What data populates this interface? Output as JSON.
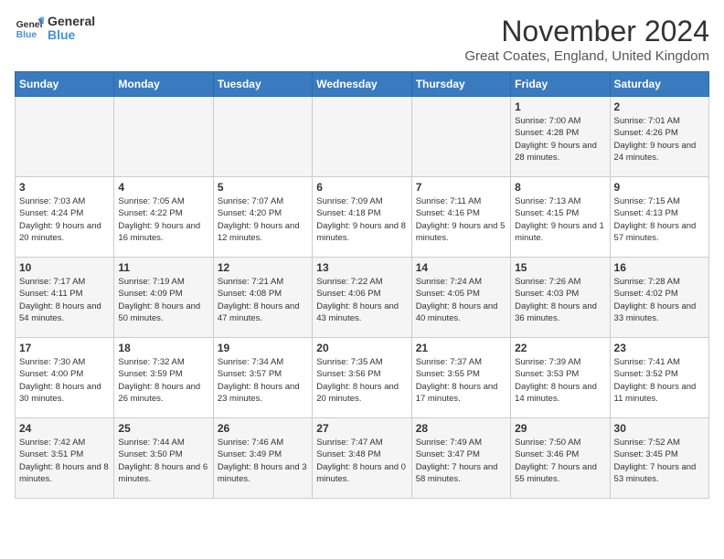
{
  "logo": {
    "general": "General",
    "blue": "Blue"
  },
  "title": "November 2024",
  "subtitle": "Great Coates, England, United Kingdom",
  "days_of_week": [
    "Sunday",
    "Monday",
    "Tuesday",
    "Wednesday",
    "Thursday",
    "Friday",
    "Saturday"
  ],
  "weeks": [
    [
      {
        "day": "",
        "info": ""
      },
      {
        "day": "",
        "info": ""
      },
      {
        "day": "",
        "info": ""
      },
      {
        "day": "",
        "info": ""
      },
      {
        "day": "",
        "info": ""
      },
      {
        "day": "1",
        "info": "Sunrise: 7:00 AM\nSunset: 4:28 PM\nDaylight: 9 hours and 28 minutes."
      },
      {
        "day": "2",
        "info": "Sunrise: 7:01 AM\nSunset: 4:26 PM\nDaylight: 9 hours and 24 minutes."
      }
    ],
    [
      {
        "day": "3",
        "info": "Sunrise: 7:03 AM\nSunset: 4:24 PM\nDaylight: 9 hours and 20 minutes."
      },
      {
        "day": "4",
        "info": "Sunrise: 7:05 AM\nSunset: 4:22 PM\nDaylight: 9 hours and 16 minutes."
      },
      {
        "day": "5",
        "info": "Sunrise: 7:07 AM\nSunset: 4:20 PM\nDaylight: 9 hours and 12 minutes."
      },
      {
        "day": "6",
        "info": "Sunrise: 7:09 AM\nSunset: 4:18 PM\nDaylight: 9 hours and 8 minutes."
      },
      {
        "day": "7",
        "info": "Sunrise: 7:11 AM\nSunset: 4:16 PM\nDaylight: 9 hours and 5 minutes."
      },
      {
        "day": "8",
        "info": "Sunrise: 7:13 AM\nSunset: 4:15 PM\nDaylight: 9 hours and 1 minute."
      },
      {
        "day": "9",
        "info": "Sunrise: 7:15 AM\nSunset: 4:13 PM\nDaylight: 8 hours and 57 minutes."
      }
    ],
    [
      {
        "day": "10",
        "info": "Sunrise: 7:17 AM\nSunset: 4:11 PM\nDaylight: 8 hours and 54 minutes."
      },
      {
        "day": "11",
        "info": "Sunrise: 7:19 AM\nSunset: 4:09 PM\nDaylight: 8 hours and 50 minutes."
      },
      {
        "day": "12",
        "info": "Sunrise: 7:21 AM\nSunset: 4:08 PM\nDaylight: 8 hours and 47 minutes."
      },
      {
        "day": "13",
        "info": "Sunrise: 7:22 AM\nSunset: 4:06 PM\nDaylight: 8 hours and 43 minutes."
      },
      {
        "day": "14",
        "info": "Sunrise: 7:24 AM\nSunset: 4:05 PM\nDaylight: 8 hours and 40 minutes."
      },
      {
        "day": "15",
        "info": "Sunrise: 7:26 AM\nSunset: 4:03 PM\nDaylight: 8 hours and 36 minutes."
      },
      {
        "day": "16",
        "info": "Sunrise: 7:28 AM\nSunset: 4:02 PM\nDaylight: 8 hours and 33 minutes."
      }
    ],
    [
      {
        "day": "17",
        "info": "Sunrise: 7:30 AM\nSunset: 4:00 PM\nDaylight: 8 hours and 30 minutes."
      },
      {
        "day": "18",
        "info": "Sunrise: 7:32 AM\nSunset: 3:59 PM\nDaylight: 8 hours and 26 minutes."
      },
      {
        "day": "19",
        "info": "Sunrise: 7:34 AM\nSunset: 3:57 PM\nDaylight: 8 hours and 23 minutes."
      },
      {
        "day": "20",
        "info": "Sunrise: 7:35 AM\nSunset: 3:56 PM\nDaylight: 8 hours and 20 minutes."
      },
      {
        "day": "21",
        "info": "Sunrise: 7:37 AM\nSunset: 3:55 PM\nDaylight: 8 hours and 17 minutes."
      },
      {
        "day": "22",
        "info": "Sunrise: 7:39 AM\nSunset: 3:53 PM\nDaylight: 8 hours and 14 minutes."
      },
      {
        "day": "23",
        "info": "Sunrise: 7:41 AM\nSunset: 3:52 PM\nDaylight: 8 hours and 11 minutes."
      }
    ],
    [
      {
        "day": "24",
        "info": "Sunrise: 7:42 AM\nSunset: 3:51 PM\nDaylight: 8 hours and 8 minutes."
      },
      {
        "day": "25",
        "info": "Sunrise: 7:44 AM\nSunset: 3:50 PM\nDaylight: 8 hours and 6 minutes."
      },
      {
        "day": "26",
        "info": "Sunrise: 7:46 AM\nSunset: 3:49 PM\nDaylight: 8 hours and 3 minutes."
      },
      {
        "day": "27",
        "info": "Sunrise: 7:47 AM\nSunset: 3:48 PM\nDaylight: 8 hours and 0 minutes."
      },
      {
        "day": "28",
        "info": "Sunrise: 7:49 AM\nSunset: 3:47 PM\nDaylight: 7 hours and 58 minutes."
      },
      {
        "day": "29",
        "info": "Sunrise: 7:50 AM\nSunset: 3:46 PM\nDaylight: 7 hours and 55 minutes."
      },
      {
        "day": "30",
        "info": "Sunrise: 7:52 AM\nSunset: 3:45 PM\nDaylight: 7 hours and 53 minutes."
      }
    ]
  ]
}
